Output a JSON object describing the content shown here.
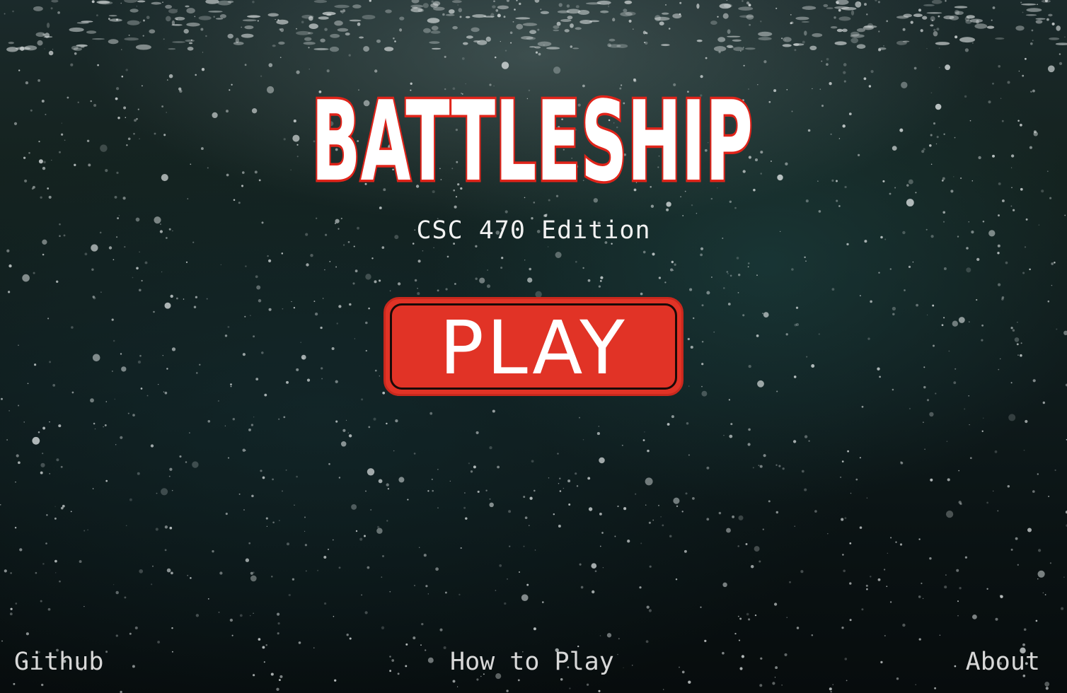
{
  "title": "BATTLESHIP",
  "subtitle": "CSC 470 Edition",
  "play_button": {
    "label": "PLAY"
  },
  "footer": {
    "github": "Github",
    "how_to_play": "How to Play",
    "about": "About"
  },
  "colors": {
    "accent": "#e13326",
    "title_fill": "#ffffff",
    "title_outline": "#e0241a"
  }
}
